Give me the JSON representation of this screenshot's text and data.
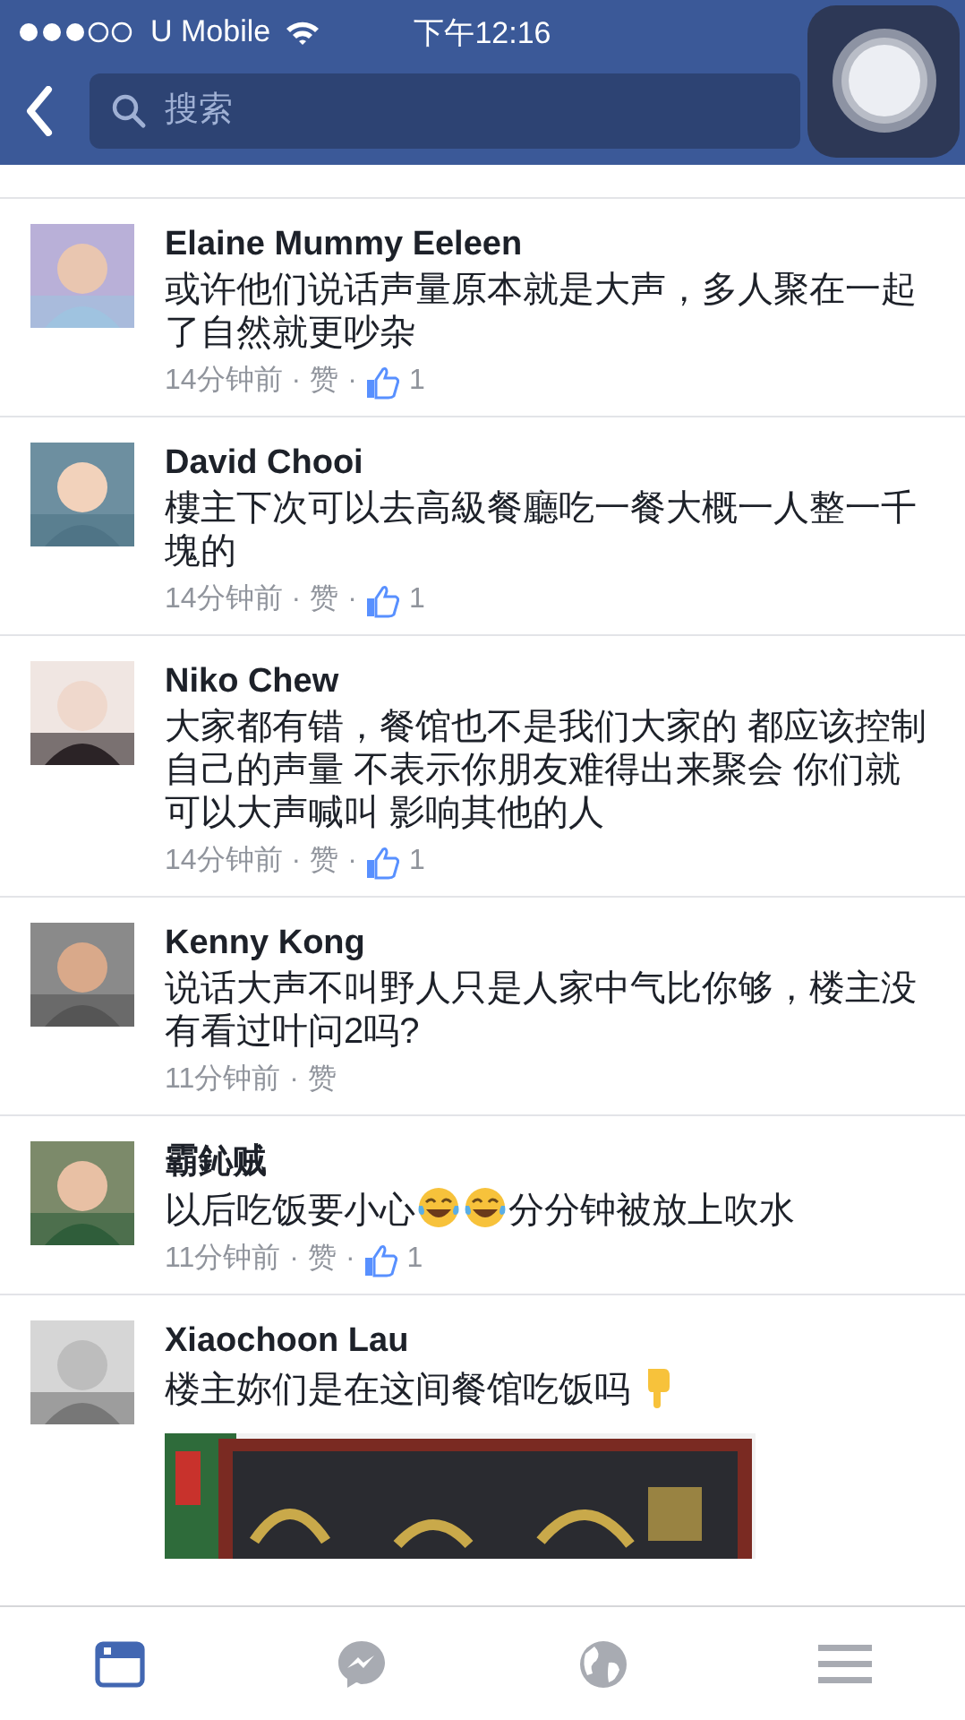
{
  "status_bar": {
    "carrier": "U Mobile",
    "time": "下午12:16"
  },
  "nav": {
    "search": {
      "placeholder": "搜索"
    }
  },
  "comments": [
    {
      "name": "Elaine Mummy Eeleen",
      "body": [
        {
          "kind": "text",
          "text": "或许他们说话声量原本就是大声，多人聚在一起了自然就更吵杂"
        }
      ],
      "meta": {
        "time": "14分钟前",
        "dots": [
          "·",
          "·"
        ],
        "action": "赞",
        "likes": "1"
      }
    },
    {
      "name": "David Chooi",
      "body": [
        {
          "kind": "text",
          "text": "樓主下次可以去高級餐廳吃一餐大概一人整一千塊的"
        }
      ],
      "meta": {
        "time": "14分钟前",
        "dots": [
          "·",
          "·"
        ],
        "action": "赞",
        "likes": "1"
      }
    },
    {
      "name": "Niko Chew",
      "body": [
        {
          "kind": "text",
          "text": "大家都有错，餐馆也不是我们大家的 都应该控制自己的声量 不表示你朋友难得出来聚会 你们就可以大声喊叫 影响其他的人"
        }
      ],
      "meta": {
        "time": "14分钟前",
        "dots": [
          "·",
          "·"
        ],
        "action": "赞",
        "likes": "1"
      }
    },
    {
      "name": "Kenny Kong",
      "body": [
        {
          "kind": "text",
          "text": "说话大声不叫野人只是人家中气比你够，楼主没有看过叶问2吗?"
        }
      ],
      "meta": {
        "time": "11分钟前",
        "dots": [
          "·"
        ],
        "action": "赞"
      }
    },
    {
      "name": "霸鈊贼",
      "body": [
        {
          "kind": "text",
          "text": "以后吃饭要小心"
        },
        {
          "kind": "tears"
        },
        {
          "kind": "tears"
        },
        {
          "kind": "text",
          "text": "分分钟被放上吹水"
        }
      ],
      "meta": {
        "time": "11分钟前",
        "dots": [
          "·",
          "·"
        ],
        "action": "赞",
        "likes": "1"
      }
    },
    {
      "name": "Xiaochoon Lau",
      "body": [
        {
          "kind": "text",
          "text": "楼主妳们是在这间餐馆吃饭吗 "
        },
        {
          "kind": "pointdown"
        }
      ]
    }
  ],
  "tabs": [
    {
      "kind": "feed",
      "selected": true
    },
    {
      "kind": "messenger",
      "selected": false
    },
    {
      "kind": "globe",
      "selected": false
    },
    {
      "kind": "menu",
      "selected": false
    }
  ]
}
